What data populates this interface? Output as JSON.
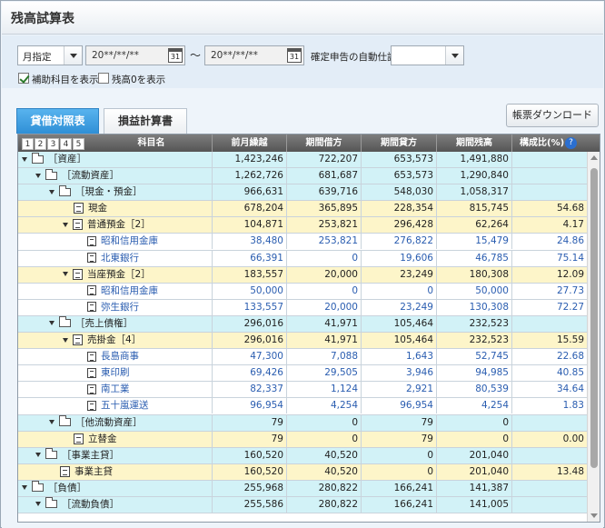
{
  "title": "残高試算表",
  "filters": {
    "period_type": "月指定",
    "date_from": "20**/**/**",
    "date_to": "20**/**/**",
    "tilde": "～",
    "auto_journal_label": "確定申告の自動仕訳",
    "auto_journal_value": "",
    "show_sub_accounts_label": "補助科目を表示",
    "show_sub_accounts_checked": true,
    "show_zero_label": "残高0を表示",
    "show_zero_checked": false
  },
  "tabs": [
    {
      "label": "貸借対照表",
      "active": true
    },
    {
      "label": "損益計算書",
      "active": false
    }
  ],
  "download_button": "帳票ダウンロード",
  "table": {
    "level_buttons": [
      "1",
      "2",
      "3",
      "4",
      "5"
    ],
    "headers": [
      "科目名",
      "前月繰越",
      "期間借方",
      "期間貸方",
      "期間残高",
      "構成比(%)"
    ],
    "help_icon": "?",
    "rows": [
      {
        "type": "g",
        "depth": 0,
        "name": "［資産］",
        "values": [
          "1,423,246",
          "722,207",
          "653,573",
          "1,491,880",
          ""
        ]
      },
      {
        "type": "g",
        "depth": 1,
        "name": "［流動資産］",
        "values": [
          "1,262,726",
          "681,687",
          "653,573",
          "1,290,840",
          ""
        ]
      },
      {
        "type": "g",
        "depth": 2,
        "name": "［現金・預金］",
        "values": [
          "966,631",
          "639,716",
          "548,030",
          "1,058,317",
          ""
        ]
      },
      {
        "type": "a",
        "depth": 3,
        "name": "現金",
        "values": [
          "678,204",
          "365,895",
          "228,354",
          "815,745",
          "54.68"
        ]
      },
      {
        "type": "a",
        "depth": 3,
        "expand": true,
        "name": "普通預金［2］",
        "values": [
          "104,871",
          "253,821",
          "296,428",
          "62,264",
          "4.17"
        ]
      },
      {
        "type": "s",
        "depth": 4,
        "name": "昭和信用金庫",
        "values": [
          "38,480",
          "253,821",
          "276,822",
          "15,479",
          "24.86"
        ]
      },
      {
        "type": "s",
        "depth": 4,
        "name": "北東銀行",
        "values": [
          "66,391",
          "0",
          "19,606",
          "46,785",
          "75.14"
        ]
      },
      {
        "type": "a",
        "depth": 3,
        "expand": true,
        "name": "当座預金［2］",
        "values": [
          "183,557",
          "20,000",
          "23,249",
          "180,308",
          "12.09"
        ]
      },
      {
        "type": "s",
        "depth": 4,
        "name": "昭和信用金庫",
        "values": [
          "50,000",
          "0",
          "0",
          "50,000",
          "27.73"
        ]
      },
      {
        "type": "s",
        "depth": 4,
        "name": "弥生銀行",
        "values": [
          "133,557",
          "20,000",
          "23,249",
          "130,308",
          "72.27"
        ]
      },
      {
        "type": "g",
        "depth": 2,
        "name": "［売上債権］",
        "values": [
          "296,016",
          "41,971",
          "105,464",
          "232,523",
          ""
        ]
      },
      {
        "type": "a",
        "depth": 3,
        "expand": true,
        "name": "売掛金［4］",
        "values": [
          "296,016",
          "41,971",
          "105,464",
          "232,523",
          "15.59"
        ]
      },
      {
        "type": "s",
        "depth": 4,
        "name": "長島商事",
        "values": [
          "47,300",
          "7,088",
          "1,643",
          "52,745",
          "22.68"
        ]
      },
      {
        "type": "s",
        "depth": 4,
        "name": "東印刷",
        "values": [
          "69,426",
          "29,505",
          "3,946",
          "94,985",
          "40.85"
        ]
      },
      {
        "type": "s",
        "depth": 4,
        "name": "南工業",
        "values": [
          "82,337",
          "1,124",
          "2,921",
          "80,539",
          "34.64"
        ]
      },
      {
        "type": "s",
        "depth": 4,
        "name": "五十嵐運送",
        "values": [
          "96,954",
          "4,254",
          "96,954",
          "4,254",
          "1.83"
        ]
      },
      {
        "type": "g",
        "depth": 2,
        "name": "［他流動資産］",
        "values": [
          "79",
          "0",
          "79",
          "0",
          ""
        ]
      },
      {
        "type": "a",
        "depth": 3,
        "name": "立替金",
        "values": [
          "79",
          "0",
          "79",
          "0",
          "0.00"
        ]
      },
      {
        "type": "g",
        "depth": 1,
        "name": "［事業主貸］",
        "values": [
          "160,520",
          "40,520",
          "0",
          "201,040",
          ""
        ]
      },
      {
        "type": "a",
        "depth": 2,
        "name": "事業主貸",
        "values": [
          "160,520",
          "40,520",
          "0",
          "201,040",
          "13.48"
        ]
      },
      {
        "type": "g",
        "depth": 0,
        "name": "［負債］",
        "values": [
          "255,968",
          "280,822",
          "166,241",
          "141,387",
          ""
        ]
      },
      {
        "type": "g",
        "depth": 1,
        "name": "［流動負債］",
        "values": [
          "255,586",
          "280,822",
          "166,241",
          "141,005",
          ""
        ]
      }
    ]
  }
}
